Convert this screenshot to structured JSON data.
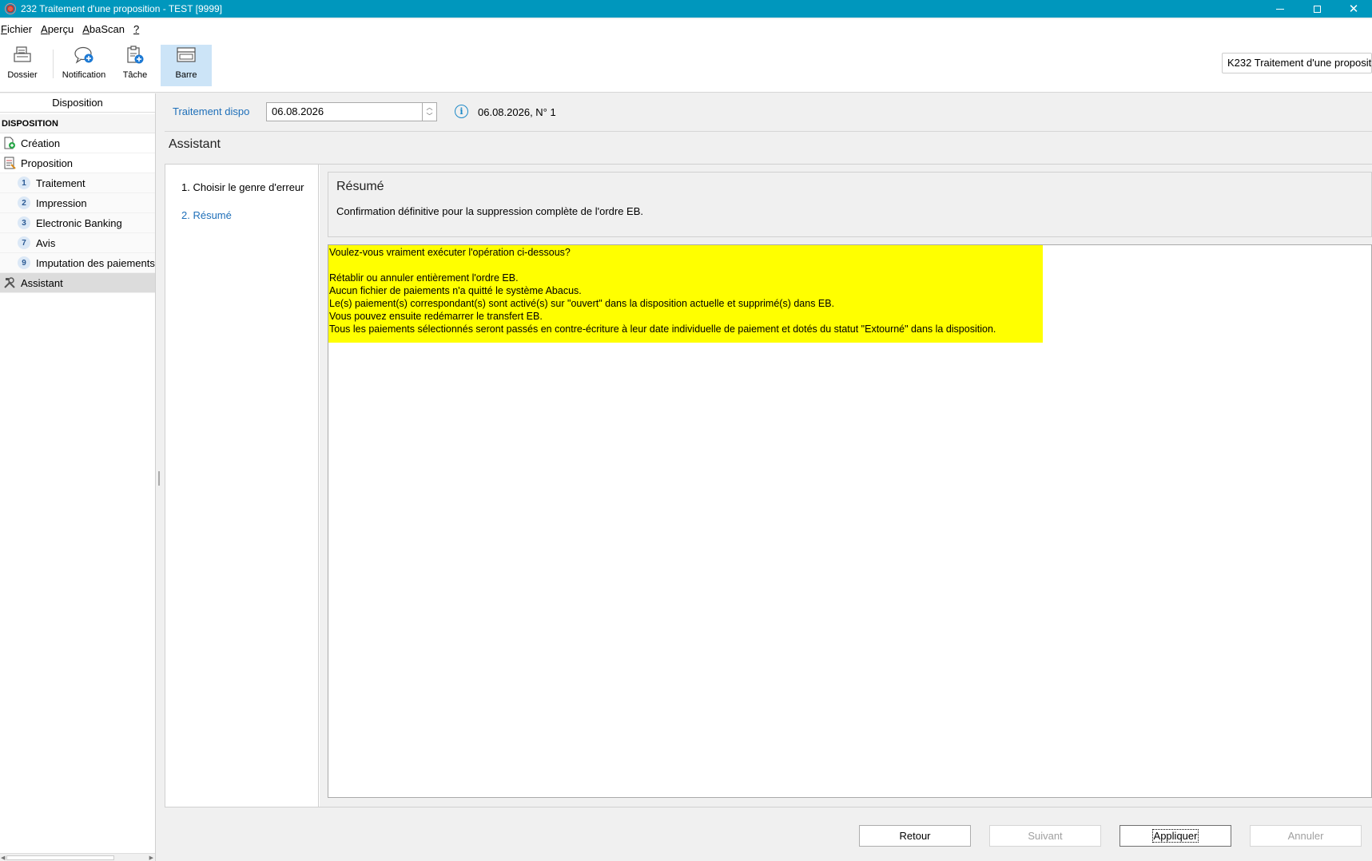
{
  "window": {
    "title": "232 Traitement d'une proposition - TEST [9999]",
    "buttons": {
      "minimize": "minimize-icon",
      "maximize": "maximize-icon",
      "close": "close-icon"
    }
  },
  "menu": [
    {
      "label": "Fichier"
    },
    {
      "label": "Aperçu"
    },
    {
      "label": "AbaScan"
    },
    {
      "label": "?"
    }
  ],
  "toolbar": {
    "dossier": "Dossier",
    "notification": "Notification",
    "tache": "Tâche",
    "barre": "Barre",
    "search_value": "K232 Traitement d'une propositi"
  },
  "sidebar": {
    "header": "Disposition",
    "section": "DISPOSITION",
    "items": [
      {
        "label": "Création",
        "icon": "add-document-icon"
      },
      {
        "label": "Proposition",
        "icon": "proposal-icon"
      }
    ],
    "subitems": [
      {
        "num": "1",
        "label": "Traitement"
      },
      {
        "num": "2",
        "label": "Impression"
      },
      {
        "num": "3",
        "label": "Electronic Banking"
      },
      {
        "num": "7",
        "label": "Avis"
      },
      {
        "num": "9",
        "label": "Imputation des paiements"
      }
    ],
    "assistant": {
      "label": "Assistant",
      "icon": "tools-icon"
    }
  },
  "filter": {
    "label": "Traitement dispo",
    "date_value": "06.08.2026",
    "result": "06.08.2026, N° 1"
  },
  "assistant": {
    "title": "Assistant",
    "steps": [
      {
        "label": "1. Choisir le genre d'erreur"
      },
      {
        "label": "2. Résumé"
      }
    ],
    "summary_title": "Résumé",
    "summary_desc": "Confirmation définitive pour la suppression complète de l'ordre EB.",
    "message_lines": [
      "Voulez-vous vraiment exécuter l'opération ci-dessous?",
      "",
      "Rétablir ou annuler entièrement l'ordre EB.",
      "Aucun fichier de paiements n'a quitté le système Abacus.",
      "Le(s) paiement(s) correspondant(s) sont activé(s) sur \"ouvert\" dans la disposition actuelle et supprimé(s) dans EB.",
      "Vous pouvez ensuite redémarrer le transfert EB.",
      "Tous les paiements sélectionnés seront passés en contre-écriture à leur date individuelle de paiement et dotés du statut \"Extourné\" dans la disposition."
    ],
    "highlight_color": "#ffff00"
  },
  "buttons": {
    "retour": "Retour",
    "suivant": "Suivant",
    "appliquer": "Appliquer",
    "annuler": "Annuler"
  },
  "colors": {
    "titlebar": "#0097bd",
    "link": "#1e6fb9"
  }
}
